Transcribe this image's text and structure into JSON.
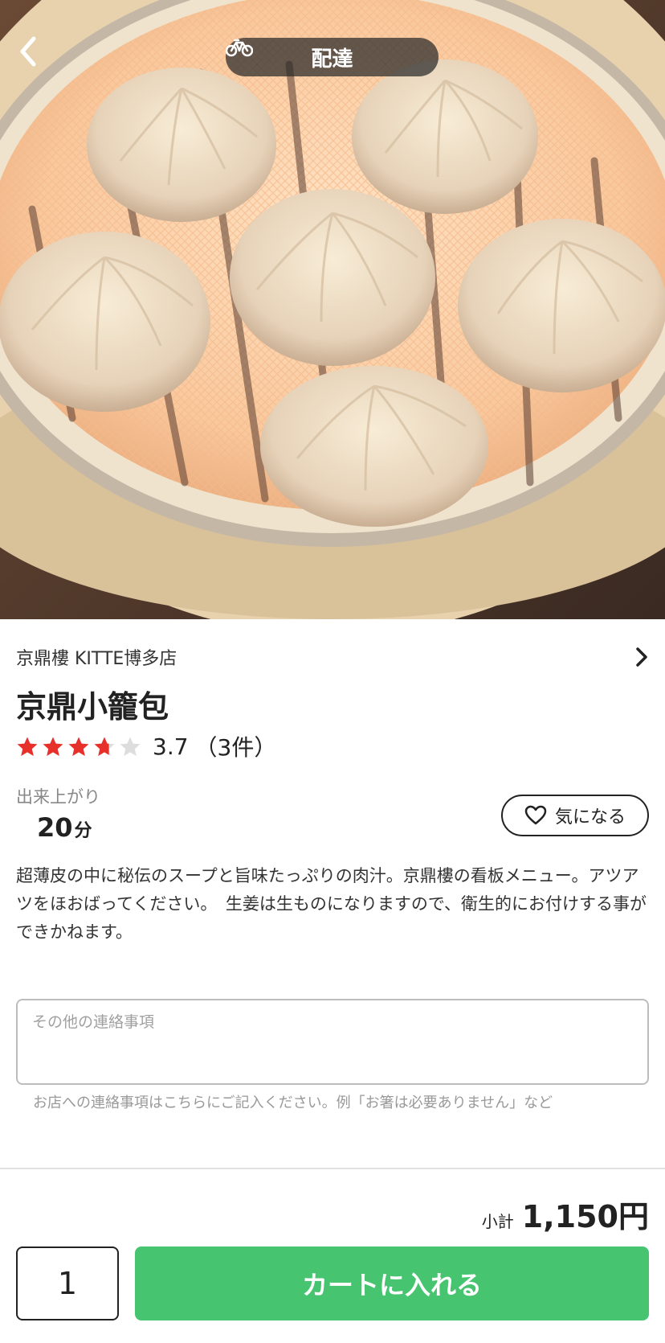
{
  "hero": {
    "mode_label": "配達",
    "image_name": "xiaolongbao-steamer-photo"
  },
  "shop": {
    "name": "京鼎樓 KITTE博多店"
  },
  "dish": {
    "title": "京鼎小籠包",
    "rating_value": 3.7,
    "rating_text": "3.7",
    "rating_count": "（3件）",
    "stars_max": 5,
    "prep_label": "出来上がり",
    "prep_value": "20",
    "prep_unit": "分",
    "favorite_label": "気になる",
    "description": "超薄皮の中に秘伝のスープと旨味たっぷりの肉汁。京鼎樓の看板メニュー。アツアツをほおばってください。　生姜は生ものになりますので、衛生的にお付けする事ができかねます。"
  },
  "note": {
    "placeholder": "その他の連絡事項",
    "value": "",
    "hint": "お店への連絡事項はこちらにご記入ください。例「お箸は必要ありません」など"
  },
  "footer": {
    "subtotal_label": "小計",
    "subtotal_amount": "1,150円",
    "quantity": "1",
    "add_to_cart_label": "カートに入れる"
  },
  "colors": {
    "accent_green": "#46c46f",
    "star_red": "#e8302a",
    "star_empty": "#dddddd"
  },
  "icons": {
    "back": "chevron-left-icon",
    "delivery": "bicycle-icon",
    "shop_link": "chevron-right-icon",
    "favorite": "heart-outline-icon",
    "star": "star-icon"
  }
}
